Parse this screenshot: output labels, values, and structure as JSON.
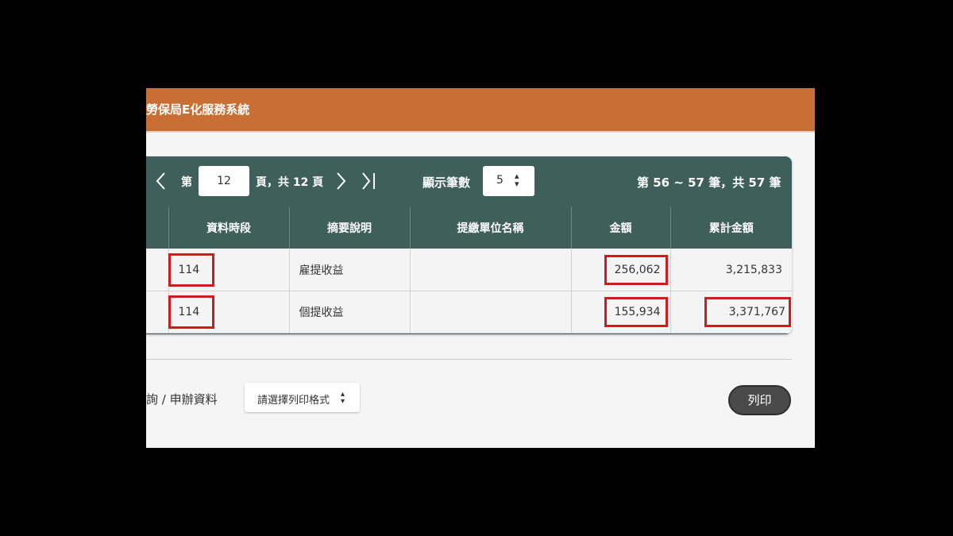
{
  "header": {
    "title": "勞保局E化服務系統"
  },
  "pager": {
    "page_prefix": "第",
    "current_page": "12",
    "page_suffix": "頁，共 12 頁",
    "page_size_label": "顯示筆數",
    "page_size_value": "5",
    "record_summary": "第 56 ~ 57 筆，共 57 筆"
  },
  "table": {
    "columns": [
      "",
      "資料時段",
      "摘要說明",
      "提繳單位名稱",
      "金額",
      "累計金額"
    ],
    "rows": [
      {
        "period": "114",
        "summary": "雇提收益",
        "unit": "",
        "amount": "256,062",
        "cumulative": "3,215,833"
      },
      {
        "period": "114",
        "summary": "個提收益",
        "unit": "",
        "amount": "155,934",
        "cumulative": "3,371,767"
      }
    ]
  },
  "footer": {
    "label": "詢 / 申辦資料",
    "format_placeholder": "請選擇列印格式",
    "print_label": "列印"
  },
  "colors": {
    "header_bg": "#c96f35",
    "table_header_bg": "#3f5f5b",
    "highlight": "#d11b1b",
    "print_button_bg": "#4a4a4a"
  }
}
